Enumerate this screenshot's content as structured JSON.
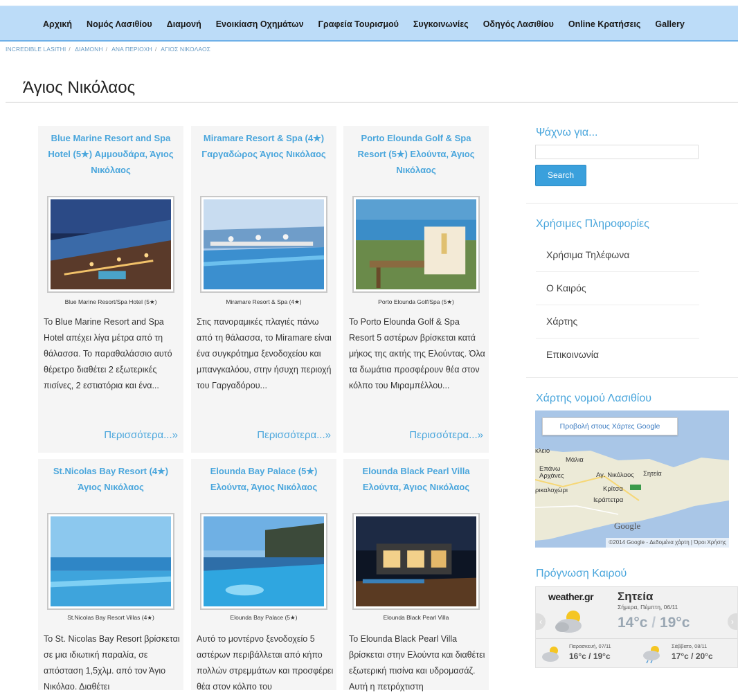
{
  "nav": {
    "items": [
      "Αρχική",
      "Νομός Λασιθίου",
      "Διαμονή",
      "Ενοικίαση Οχημάτων",
      "Γραφεία Τουρισμού",
      "Συγκοινωνίες",
      "Οδηγός Λασιθίου",
      "Online Κρατήσεις",
      "Gallery"
    ]
  },
  "breadcrumb": [
    "INCREDIBLE LASITHI",
    "ΔΙΑΜΟΝΗ",
    "ΑΝΑ ΠΕΡΙΟΧΗ",
    "ΑΓΙΟΣ ΝΙΚΟΛΑΟΣ"
  ],
  "page": {
    "title": "Άγιος Νικόλαος"
  },
  "cards": [
    {
      "title": "Blue Marine Resort and Spa Hotel (5★) Αμμουδάρα, Άγιος Νικόλαος",
      "caption": "Blue Marine Resort/Spa Hotel (5★)",
      "text": "Το Blue Marine Resort and Spa Hotel απέχει λίγα μέτρα από τη θάλασσα. Το παραθαλάσσιο αυτό θέρετρο διαθέτει 2 εξωτερικές πισίνες, 2 εστιατόρια και ένα...",
      "more": "Περισσότερα...»"
    },
    {
      "title": "Miramare Resort & Spa (4★) Γαργαδώρος Άγιος Νικόλαος",
      "caption": "Miramare Resort & Spa (4★)",
      "text": "Στις πανοραμικές πλαγιές πάνω από τη θάλασσα, το Miramare είναι ένα συγκρότημα ξενοδοχείου και μπανγκαλόου, στην ήσυχη περιοχή του Γαργαδόρου...",
      "more": "Περισσότερα...»"
    },
    {
      "title": "Porto Elounda Golf & Spa Resort (5★) Ελούντα, Άγιος Νικόλαος",
      "caption": "Porto Elounda Golf/Spa (5★)",
      "text": "Το Porto Elounda Golf & Spa Resort 5 αστέρων βρίσκεται κατά μήκος της ακτής της Ελούντας. Όλα τα δωμάτια προσφέρουν θέα στον κόλπο του Μιραμπέλλου...",
      "more": "Περισσότερα...»"
    },
    {
      "title": "St.Nicolas Bay Resort (4★) Άγιος Νικόλαος",
      "caption": "St.Nicolas Bay Resort Villas (4★)",
      "text": "Το St. Nicolas Bay Resort βρίσκεται σε μια ιδιωτική παραλία, σε απόσταση 1,5χλμ. από τον Άγιο Νικόλαο. Διαθέτει",
      "more": ""
    },
    {
      "title": "Elounda Bay Palace (5★) Ελούντα, Άγιος Νικόλαος",
      "caption": "Elounda Bay Palace (5★)",
      "text": "Αυτό το μοντέρνο ξενοδοχείο 5 αστέρων περιβάλλεται από κήπο πολλών στρεμμάτων και προσφέρει θέα στον κόλπο του",
      "more": ""
    },
    {
      "title": "Elounda Black Pearl Villa Ελούντα, Άγιος Νικόλαος",
      "caption": "Elounda Black Pearl Villa",
      "text": "To Elounda Black Pearl Villa βρίσκεται στην Ελούντα και διαθέτει εξωτερική πισίνα και υδρομασάζ. Αυτή η πετρόχτιστη",
      "more": ""
    }
  ],
  "sidebar": {
    "search_heading": "Ψάχνω για...",
    "search_placeholder": "",
    "search_button": "Search",
    "info_heading": "Χρήσιμες Πληροφορίες",
    "info_items": [
      "Χρήσιμα Τηλέφωνα",
      "Ο Καιρός",
      "Χάρτης",
      "Επικοινωνία"
    ],
    "map_heading": "Χάρτης νομού Λασιθίου",
    "map_button": "Προβολή στους Χάρτες Google",
    "map_labels": [
      "κλειο",
      "Μάλια",
      "Επάνω Αρχάνες",
      "Αγ. Νικόλαος",
      "Σητεία",
      "ρικαλοχώρι",
      "Κρίτσα",
      "Ιεράπετρα",
      "Google"
    ],
    "map_attr": "©2014 Google - Δεδομένα χάρτη | Όροι Χρήσης",
    "weather_heading": "Πρόγνωση Καιρού",
    "weather": {
      "logo": "weather.gr",
      "city": "Σητεία",
      "date": "Σήμερα, Πέμπτη, 06/11",
      "temp_low": "14°c",
      "temp_high": "19°c",
      "day1_label": "Παρασκευή, 07/11",
      "day1_temp": "16°c / 19°c",
      "day2_label": "Σάββατο, 08/11",
      "day2_temp": "17°c / 20°c"
    }
  }
}
